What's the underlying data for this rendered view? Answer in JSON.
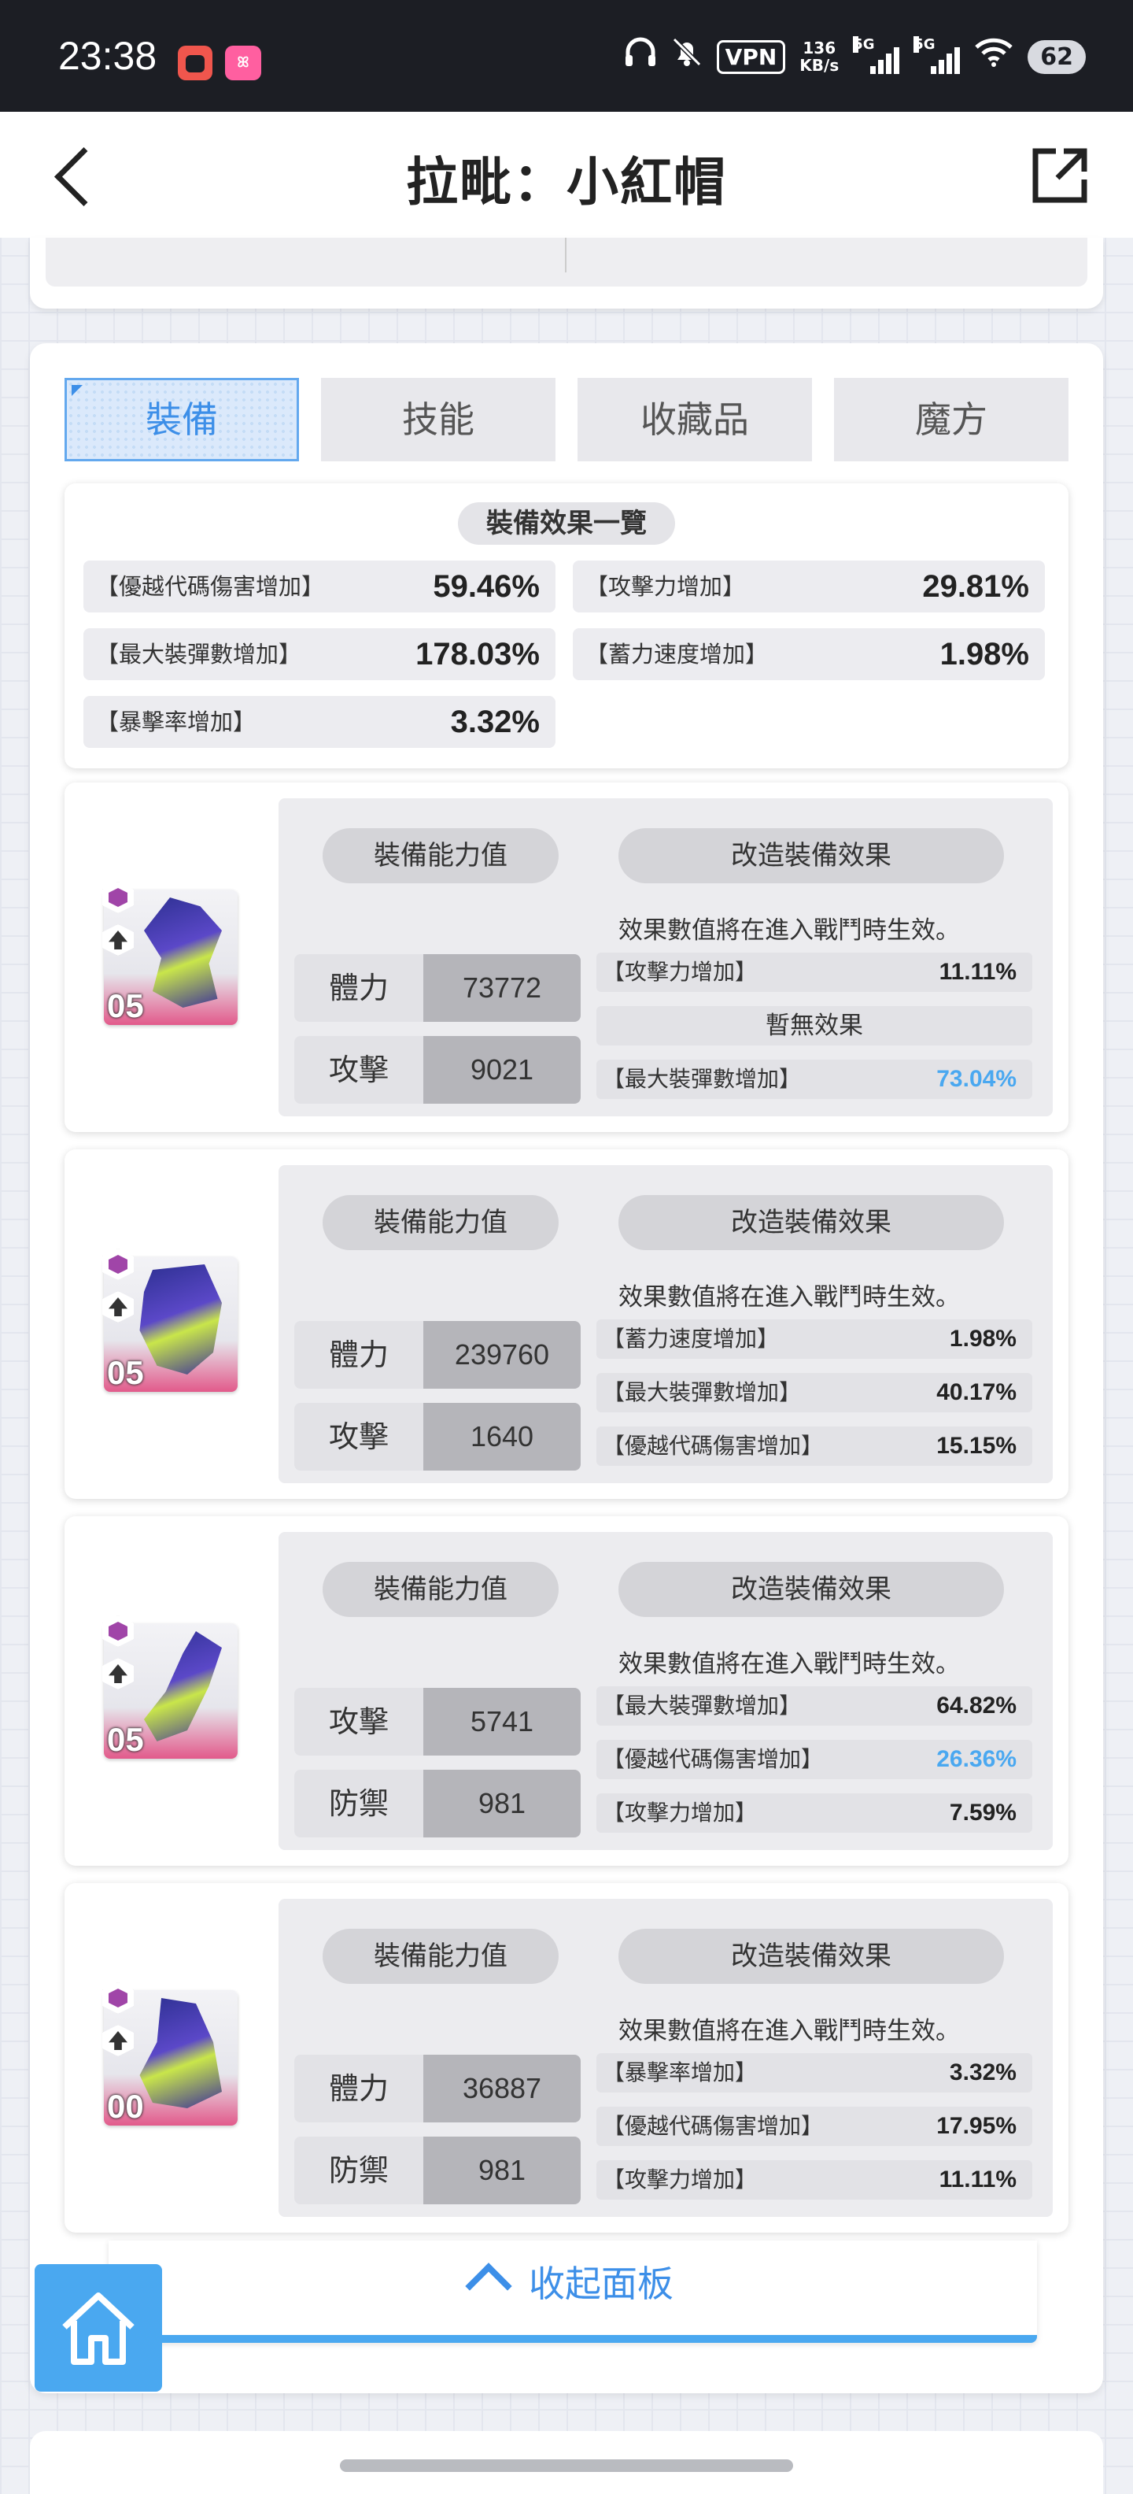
{
  "status_bar": {
    "time": "23:38",
    "speed_value": "136",
    "speed_unit": "KB/s",
    "signal1": "5G",
    "signal2": "5G",
    "vpn": "VPN",
    "battery": "62"
  },
  "header": {
    "title": "拉毗：小紅帽"
  },
  "tabs": [
    {
      "label": "裝備",
      "active": true
    },
    {
      "label": "技能",
      "active": false
    },
    {
      "label": "收藏品",
      "active": false
    },
    {
      "label": "魔方",
      "active": false
    }
  ],
  "summary": {
    "title": "裝備效果一覽",
    "items": [
      {
        "label": "【優越代碼傷害增加】",
        "value": "59.46%"
      },
      {
        "label": "【攻擊力增加】",
        "value": "29.81%"
      },
      {
        "label": "【最大裝彈數增加】",
        "value": "178.03%"
      },
      {
        "label": "【蓄力速度增加】",
        "value": "1.98%"
      },
      {
        "label": "【暴擊率增加】",
        "value": "3.32%"
      }
    ]
  },
  "equipment": [
    {
      "level": "05",
      "stats_title": "裝備能力值",
      "effects_title": "改造裝備效果",
      "note": "效果數值將在進入戰鬥時生效。",
      "stats": [
        {
          "name": "體力",
          "value": "73772"
        },
        {
          "name": "攻擊",
          "value": "9021"
        }
      ],
      "effects": [
        {
          "label": "【攻擊力增加】",
          "value": "11.11%",
          "highlight": false
        },
        {
          "label": "暫無效果",
          "value": "",
          "highlight": false,
          "empty": true
        },
        {
          "label": "【最大裝彈數增加】",
          "value": "73.04%",
          "highlight": true
        }
      ]
    },
    {
      "level": "05",
      "stats_title": "裝備能力值",
      "effects_title": "改造裝備效果",
      "note": "效果數值將在進入戰鬥時生效。",
      "stats": [
        {
          "name": "體力",
          "value": "239760"
        },
        {
          "name": "攻擊",
          "value": "1640"
        }
      ],
      "effects": [
        {
          "label": "【蓄力速度增加】",
          "value": "1.98%",
          "highlight": false
        },
        {
          "label": "【最大裝彈數增加】",
          "value": "40.17%",
          "highlight": false
        },
        {
          "label": "【優越代碼傷害增加】",
          "value": "15.15%",
          "highlight": false
        }
      ]
    },
    {
      "level": "05",
      "stats_title": "裝備能力值",
      "effects_title": "改造裝備效果",
      "note": "效果數值將在進入戰鬥時生效。",
      "stats": [
        {
          "name": "攻擊",
          "value": "5741"
        },
        {
          "name": "防禦",
          "value": "981"
        }
      ],
      "effects": [
        {
          "label": "【最大裝彈數增加】",
          "value": "64.82%",
          "highlight": false
        },
        {
          "label": "【優越代碼傷害增加】",
          "value": "26.36%",
          "highlight": true
        },
        {
          "label": "【攻擊力增加】",
          "value": "7.59%",
          "highlight": false
        }
      ]
    },
    {
      "level": "00",
      "stats_title": "裝備能力值",
      "effects_title": "改造裝備效果",
      "note": "效果數值將在進入戰鬥時生效。",
      "stats": [
        {
          "name": "體力",
          "value": "36887"
        },
        {
          "name": "防禦",
          "value": "981"
        }
      ],
      "effects": [
        {
          "label": "【暴擊率增加】",
          "value": "3.32%",
          "highlight": false
        },
        {
          "label": "【優越代碼傷害增加】",
          "value": "17.95%",
          "highlight": false
        },
        {
          "label": "【攻擊力增加】",
          "value": "11.11%",
          "highlight": false
        }
      ]
    }
  ],
  "collapse": {
    "label": "收起面板"
  },
  "colors": {
    "accent": "#4aa8f0",
    "status_bg": "#1c1e24",
    "highlight_value": "#4aa8f0"
  },
  "icons": [
    "back-arrow-icon",
    "share-icon",
    "home-icon",
    "chevron-up-icon",
    "headphones-icon",
    "bell-muted-icon",
    "wifi-icon"
  ]
}
